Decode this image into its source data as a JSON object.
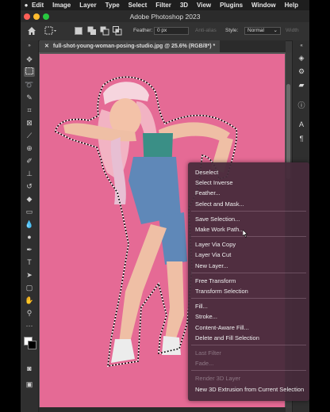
{
  "menubar": {
    "apple": "",
    "items": [
      "Edit",
      "Image",
      "Layer",
      "Type",
      "Select",
      "Filter",
      "3D",
      "View",
      "Plugins",
      "Window",
      "Help"
    ]
  },
  "window": {
    "title": "Adobe Photoshop 2023"
  },
  "options": {
    "feather_label": "Feather:",
    "feather_value": "0 px",
    "antialias_label": "Anti-alias",
    "style_label": "Style:",
    "style_value": "Normal",
    "width_label": "Width"
  },
  "document": {
    "tab_title": "full-shot-young-woman-posing-studio.jpg @ 25.6% (RGB/8*) *"
  },
  "context_menu": {
    "groups": [
      [
        {
          "label": "Deselect",
          "enabled": true
        },
        {
          "label": "Select Inverse",
          "enabled": true
        },
        {
          "label": "Feather...",
          "enabled": true
        },
        {
          "label": "Select and Mask...",
          "enabled": true
        }
      ],
      [
        {
          "label": "Save Selection...",
          "enabled": true
        },
        {
          "label": "Make Work Path...",
          "enabled": true
        }
      ],
      [
        {
          "label": "Layer Via Copy",
          "enabled": true
        },
        {
          "label": "Layer Via Cut",
          "enabled": true
        },
        {
          "label": "New Layer...",
          "enabled": true
        }
      ],
      [
        {
          "label": "Free Transform",
          "enabled": true
        },
        {
          "label": "Transform Selection",
          "enabled": true
        }
      ],
      [
        {
          "label": "Fill...",
          "enabled": true
        },
        {
          "label": "Stroke...",
          "enabled": true
        },
        {
          "label": "Content-Aware Fill...",
          "enabled": true
        },
        {
          "label": "Delete and Fill Selection",
          "enabled": true
        }
      ],
      [
        {
          "label": "Last Filter",
          "enabled": false
        },
        {
          "label": "Fade...",
          "enabled": false
        }
      ],
      [
        {
          "label": "Render 3D Layer",
          "enabled": false
        },
        {
          "label": "New 3D Extrusion from Current Selection",
          "enabled": true
        }
      ]
    ]
  },
  "colors": {
    "canvas_bg": "#e56a95",
    "menu_bg": "#462a3a",
    "accent": "#ffffff"
  }
}
